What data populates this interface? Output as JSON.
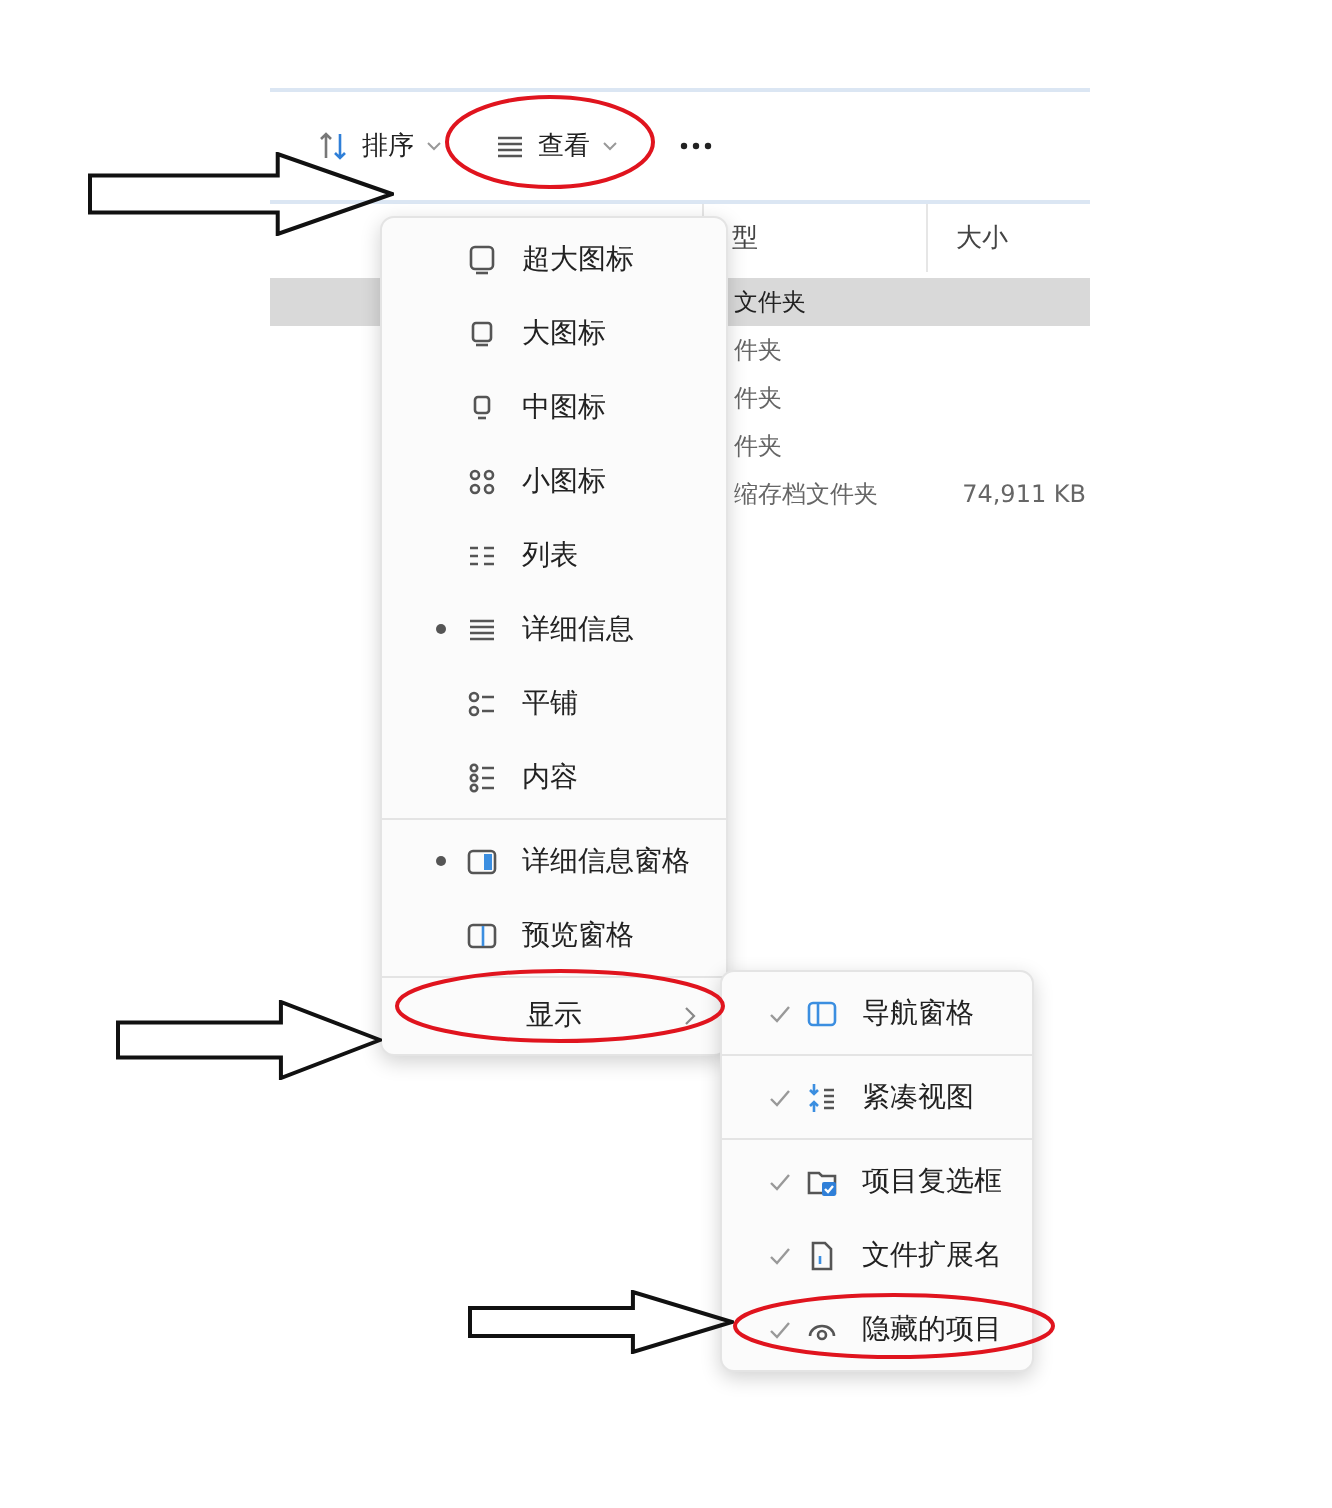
{
  "toolbar": [
    {
      "kind": "sort",
      "label": "排序"
    },
    {
      "kind": "view",
      "label": "查看"
    },
    {
      "kind": "more"
    }
  ],
  "columns": [
    "型",
    "大小"
  ],
  "rows": [
    {
      "type": "文件夹",
      "selected": true
    },
    {
      "type": "件夹",
      "selected": false
    },
    {
      "type": "件夹",
      "selected": false
    },
    {
      "type": "件夹",
      "selected": false
    },
    {
      "type": "缩存档文件夹",
      "size": "74,911 KB",
      "selected": false
    }
  ],
  "view_menu": {
    "layouts": [
      {
        "label": "超大图标",
        "selected": false
      },
      {
        "label": "大图标",
        "selected": false
      },
      {
        "label": "中图标",
        "selected": false
      },
      {
        "label": "小图标",
        "selected": false
      },
      {
        "label": "列表",
        "selected": false
      },
      {
        "label": "详细信息",
        "selected": true
      },
      {
        "label": "平铺",
        "selected": false
      },
      {
        "label": "内容",
        "selected": false
      }
    ],
    "panes": [
      {
        "label": "详细信息窗格",
        "checked": true
      },
      {
        "label": "预览窗格",
        "checked": false
      }
    ],
    "show": {
      "label": "显示",
      "expanded": true
    }
  },
  "show_menu": [
    {
      "label": "导航窗格",
      "checked": true
    },
    {
      "label": "紧凑视图",
      "checked": true
    },
    {
      "label": "项目复选框",
      "checked": true
    },
    {
      "label": "文件扩展名",
      "checked": true
    },
    {
      "label": "隐藏的项目",
      "checked": true
    }
  ]
}
